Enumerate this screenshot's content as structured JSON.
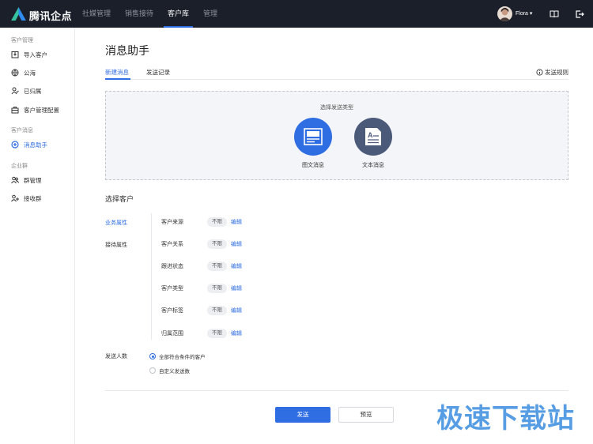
{
  "app": {
    "brand": "腾讯企点",
    "user": "Flora ▾"
  },
  "topnav": [
    {
      "label": "社媒管理"
    },
    {
      "label": "销售接待"
    },
    {
      "label": "客户库"
    },
    {
      "label": "管理"
    }
  ],
  "sidebar": {
    "groups": [
      "客户管理",
      "客户消息",
      "企业群"
    ],
    "items": [
      {
        "label": "导入客户",
        "icon": "import-icon"
      },
      {
        "label": "公海",
        "icon": "globe-icon"
      },
      {
        "label": "已归属",
        "icon": "user-check-icon"
      },
      {
        "label": "客户管理配置",
        "icon": "briefcase-icon"
      },
      {
        "label": "消息助手",
        "icon": "plus-circle-icon"
      },
      {
        "label": "群管理",
        "icon": "group-icon"
      },
      {
        "label": "接收群",
        "icon": "group-add-icon"
      }
    ]
  },
  "main": {
    "title": "消息助手",
    "tabs": [
      {
        "label": "新建消息"
      },
      {
        "label": "发送记录"
      }
    ],
    "rules_label": "发送规则",
    "dropzone": {
      "title": "选择发送类型",
      "types": [
        {
          "label": "图文消息",
          "color": "#2f6ee2"
        },
        {
          "label": "文本消息",
          "color": "#4c5a7a"
        }
      ]
    },
    "select_customers": {
      "title": "选择客户",
      "attr_tabs": [
        "业务属性",
        "接待属性"
      ],
      "filters": [
        {
          "label": "客户来源",
          "value": "不限",
          "edit": "编辑"
        },
        {
          "label": "客户关系",
          "value": "不限",
          "edit": "编辑"
        },
        {
          "label": "跟进状态",
          "value": "不限",
          "edit": "编辑"
        },
        {
          "label": "客户类型",
          "value": "不限",
          "edit": "编辑"
        },
        {
          "label": "客户标签",
          "value": "不限",
          "edit": "编辑"
        },
        {
          "label": "归属范围",
          "value": "不限",
          "edit": "编辑"
        }
      ]
    },
    "send_count": {
      "label": "发送人数",
      "options": [
        {
          "label": "全部符合条件的客户",
          "selected": true
        },
        {
          "label": "自定义发送数",
          "selected": false
        }
      ]
    },
    "buttons": {
      "send": "发送",
      "preview": "预览"
    }
  },
  "watermark": "极速下载站",
  "colors": {
    "accent": "#2f6ee2",
    "topbar": "#1b1f2a"
  }
}
